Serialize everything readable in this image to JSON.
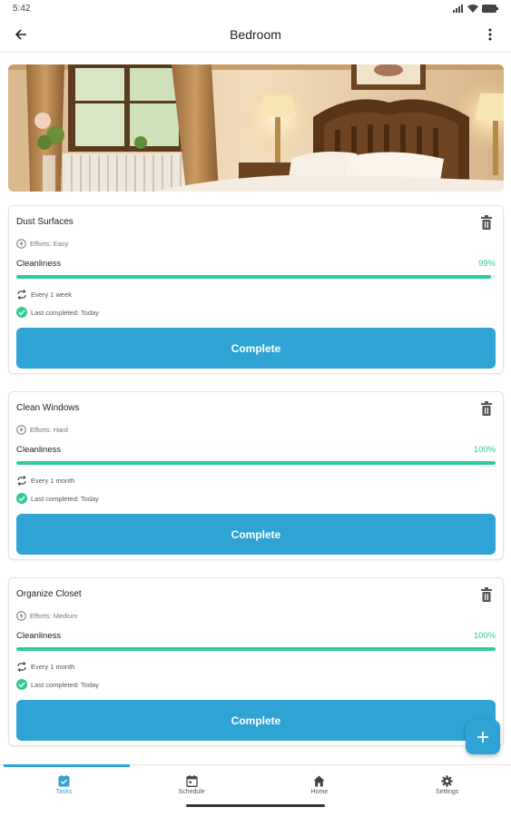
{
  "status_bar": {
    "time": "5:42"
  },
  "app_bar": {
    "title": "Bedroom"
  },
  "tasks": [
    {
      "title": "Dust Surfaces",
      "effort": "Efforts: Easy",
      "cleanliness_label": "Cleanliness",
      "cleanliness_pct": "99%",
      "cleanliness_value": 0.99,
      "frequency": "Every 1 week",
      "last_completed": "Last completed: Today",
      "button": "Complete"
    },
    {
      "title": "Clean Windows",
      "effort": "Efforts: Hard",
      "cleanliness_label": "Cleanliness",
      "cleanliness_pct": "100%",
      "cleanliness_value": 1.0,
      "frequency": "Every 1 month",
      "last_completed": "Last completed: Today",
      "button": "Complete"
    },
    {
      "title": "Organize Closet",
      "effort": "Efforts: Medium",
      "cleanliness_label": "Cleanliness",
      "cleanliness_pct": "100%",
      "cleanliness_value": 1.0,
      "frequency": "Every 1 month",
      "last_completed": "Last completed: Today",
      "button": "Complete"
    }
  ],
  "fab": {
    "icon": "plus-icon"
  },
  "bottom_nav": {
    "items": [
      {
        "label": "Tasks",
        "icon": "tasks-icon",
        "active": true
      },
      {
        "label": "Schedule",
        "icon": "calendar-icon",
        "active": false
      },
      {
        "label": "Home",
        "icon": "home-icon",
        "active": false
      },
      {
        "label": "Settings",
        "icon": "gear-icon",
        "active": false
      }
    ]
  },
  "colors": {
    "accent": "#2fa3d4",
    "progress": "#2ecc8f"
  }
}
